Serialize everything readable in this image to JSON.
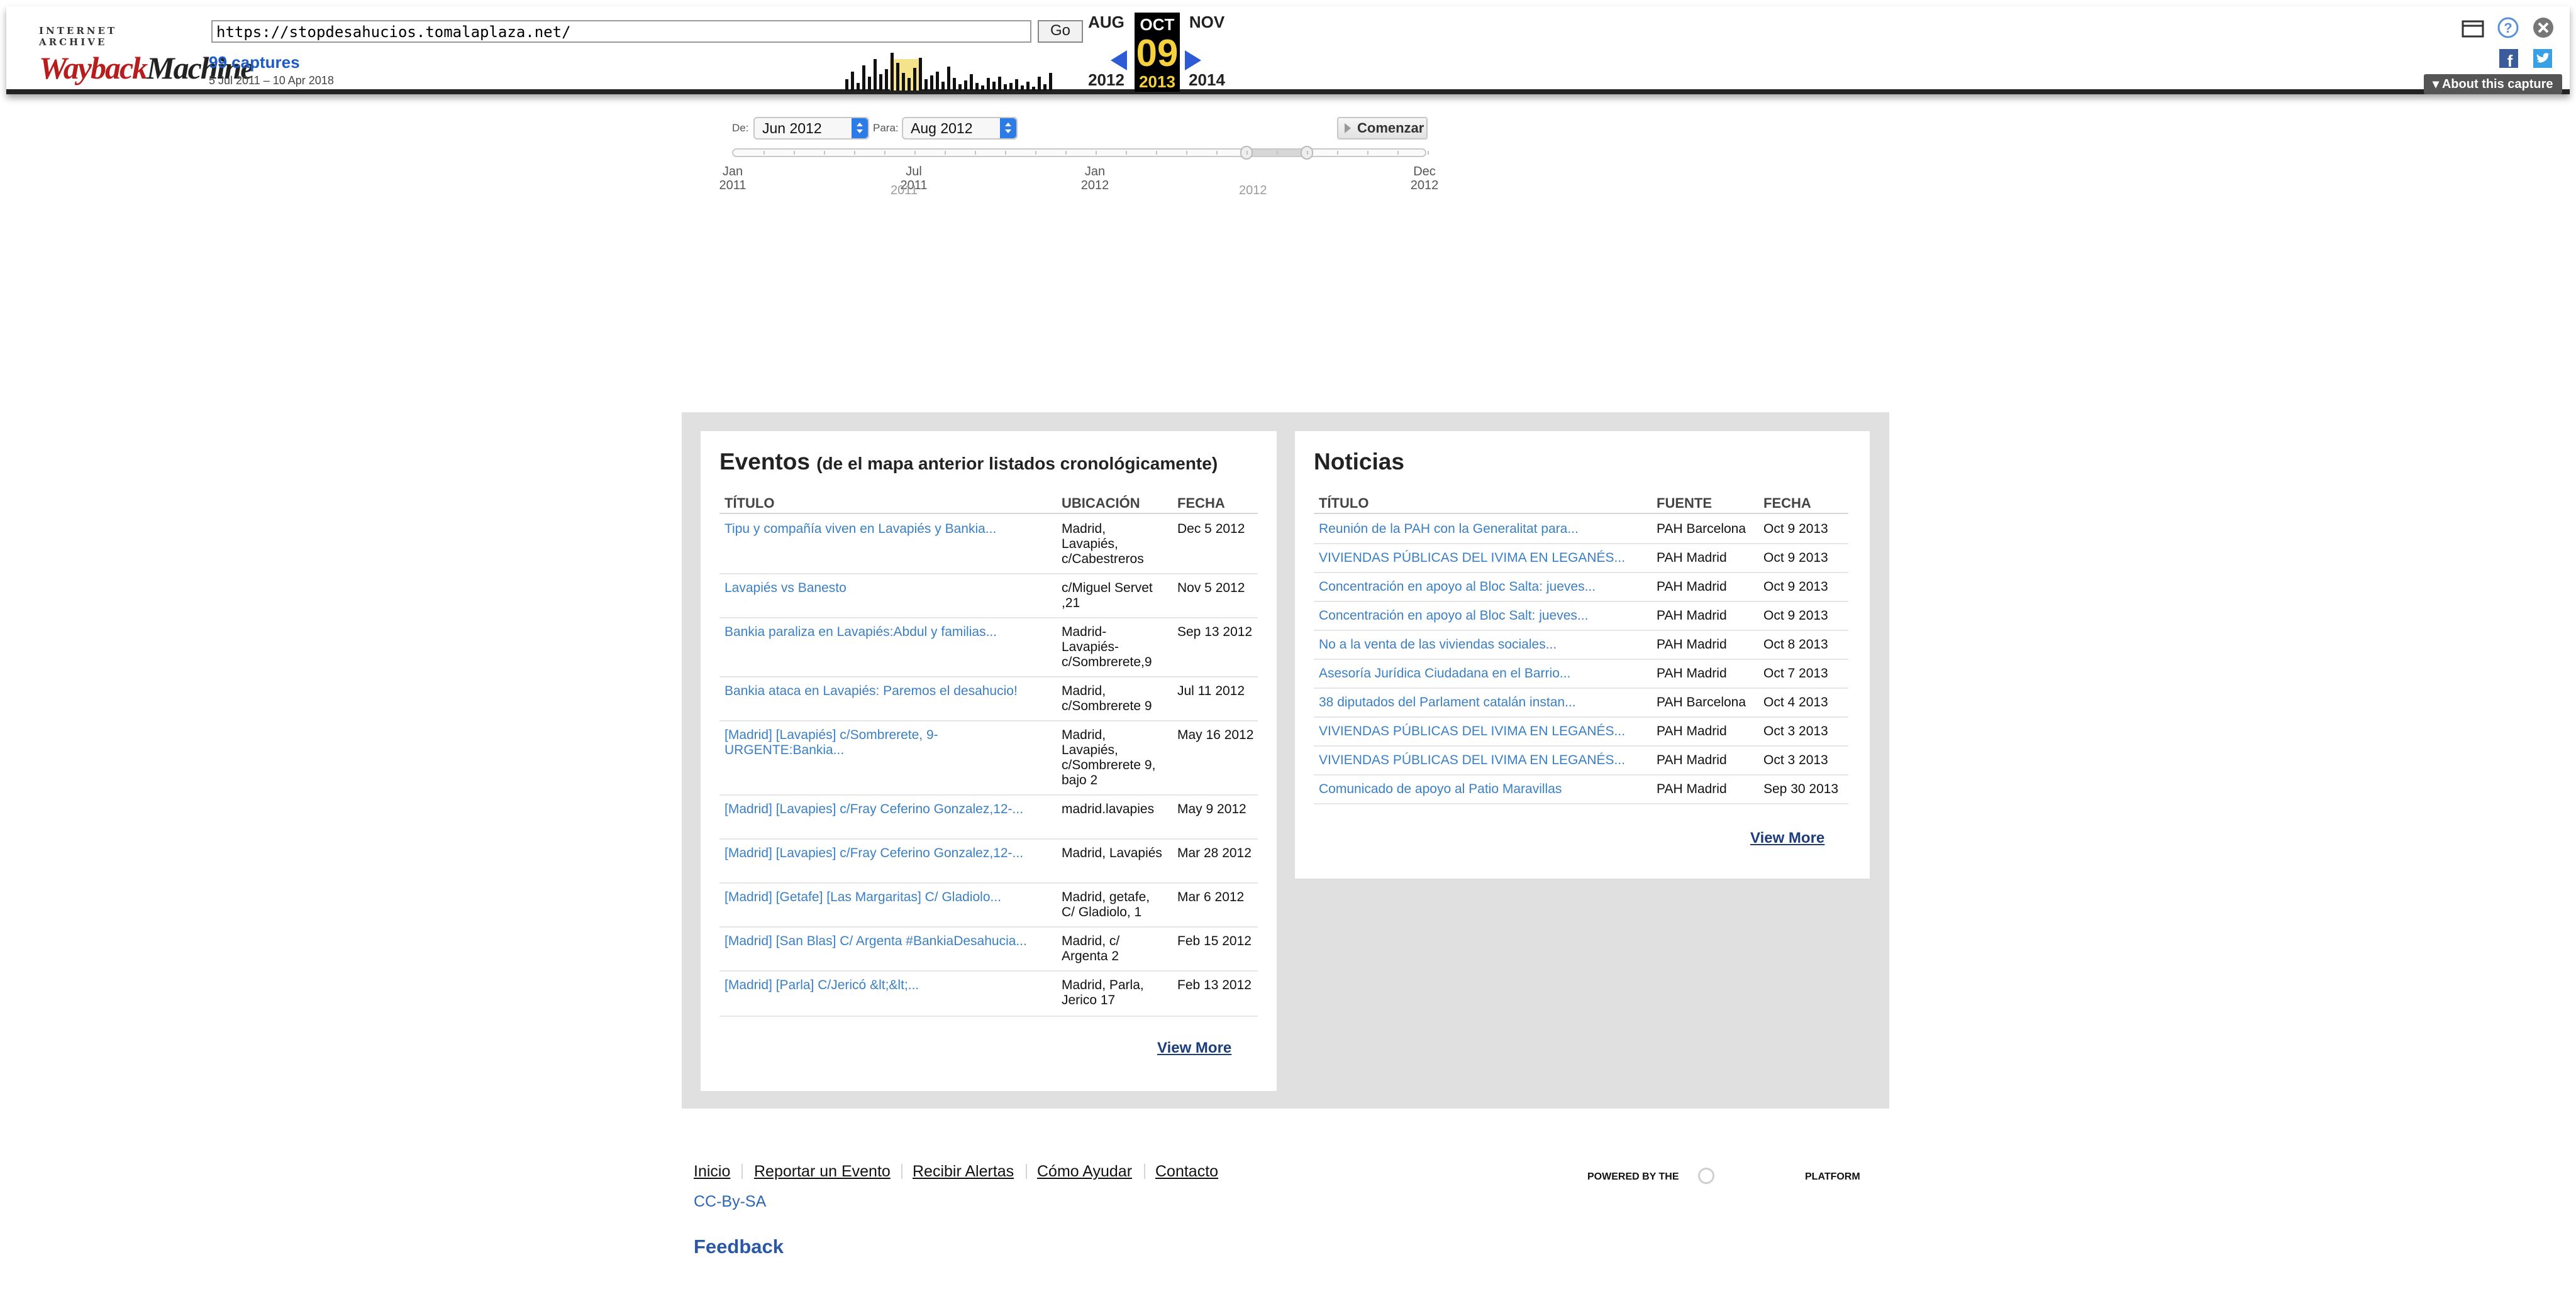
{
  "wayback": {
    "logo_top": "INTERNET ARCHIVE",
    "logo_way": "Wayback",
    "logo_machine": "Machine",
    "url": "https://stopdesahucios.tomalaplaza.net/",
    "go_label": "Go",
    "captures": "99 captures",
    "date_range": "5 Jul 2011 – 10 Apr 2018",
    "prev_month": "AUG",
    "cur_month": "OCT",
    "next_month": "NOV",
    "prev_year": "2012",
    "cur_day": "09",
    "cur_year": "2013",
    "next_year": "2014",
    "about_label": "About this capture",
    "icons": [
      "window-icon",
      "help-icon",
      "close-icon",
      "facebook-icon",
      "twitter-icon"
    ]
  },
  "timeline": {
    "from_label": "De:",
    "from_value": "Jun 2012",
    "to_label": "Para:",
    "to_value": "Aug 2012",
    "start_label": "Comenzar",
    "axis": [
      {
        "m": "Jan",
        "y": "2011"
      },
      {
        "m": "Jul",
        "y": "2011"
      },
      {
        "m": "Jan",
        "y": "2012"
      },
      {
        "m": "Dec",
        "y": "2012"
      }
    ],
    "year_labels": [
      "2011",
      "2012"
    ]
  },
  "events": {
    "title": "Eventos",
    "subtitle": "(de el mapa anterior listados cronológicamente)",
    "columns": [
      "TÍTULO",
      "UBICACIÓN",
      "FECHA"
    ],
    "rows": [
      {
        "title": "Tipu y compañía viven en Lavapiés y Bankia...",
        "loc": "Madrid, Lavapiés, c/Cabestreros",
        "date": "Dec 5 2012"
      },
      {
        "title": "Lavapiés vs Banesto",
        "loc": "c/Miguel Servet ,21",
        "date": "Nov 5 2012"
      },
      {
        "title": "Bankia paraliza en Lavapiés:Abdul y familias...",
        "loc": "Madrid-Lavapiés-c/Sombrerete,9",
        "date": "Sep 13 2012"
      },
      {
        "title": "Bankia ataca en Lavapiés: Paremos el desahucio!",
        "loc": "Madrid, c/Sombrerete 9",
        "date": "Jul 11 2012"
      },
      {
        "title": "[Madrid] [Lavapiés] c/Sombrerete, 9-URGENTE:Bankia...",
        "loc": "Madrid, Lavapiés, c/Sombrerete 9, bajo 2",
        "date": "May 16 2012"
      },
      {
        "title": "[Madrid] [Lavapies] c/Fray Ceferino Gonzalez,12-...",
        "loc": "madrid.lavapies",
        "date": "May 9 2012"
      },
      {
        "title": "[Madrid] [Lavapies] c/Fray Ceferino Gonzalez,12-...",
        "loc": "Madrid, Lavapiés",
        "date": "Mar 28 2012"
      },
      {
        "title": "[Madrid] [Getafe] [Las Margaritas] C/ Gladiolo...",
        "loc": "Madrid, getafe, C/ Gladiolo, 1",
        "date": "Mar 6 2012"
      },
      {
        "title": "[Madrid] [San Blas] C/ Argenta #BankiaDesahucia...",
        "loc": "Madrid, c/ Argenta 2",
        "date": "Feb 15 2012"
      },
      {
        "title": "[Madrid] [Parla] C/Jericó &lt;&lt;...",
        "loc": "Madrid, Parla, Jerico 17",
        "date": "Feb 13 2012"
      }
    ],
    "view_more": "View More"
  },
  "news": {
    "title": "Noticias",
    "columns": [
      "TÍTULO",
      "FUENTE",
      "FECHA"
    ],
    "rows": [
      {
        "title": "Reunión de la PAH con la Generalitat para...",
        "src": "PAH Barcelona",
        "date": "Oct 9 2013"
      },
      {
        "title": "VIVIENDAS PÚBLICAS DEL IVIMA EN LEGANÉS...",
        "src": "PAH Madrid",
        "date": "Oct 9 2013"
      },
      {
        "title": "Concentración en apoyo al Bloc Salta: jueves...",
        "src": "PAH Madrid",
        "date": "Oct 9 2013"
      },
      {
        "title": "Concentración en apoyo al Bloc Salt: jueves...",
        "src": "PAH Madrid",
        "date": "Oct 9 2013"
      },
      {
        "title": "No a la venta de las viviendas sociales...",
        "src": "PAH Madrid",
        "date": "Oct 8 2013"
      },
      {
        "title": "Asesoría Jurídica Ciudadana en el Barrio...",
        "src": "PAH Madrid",
        "date": "Oct 7 2013"
      },
      {
        "title": "38 diputados del Parlament catalán instan...",
        "src": "PAH Barcelona",
        "date": "Oct 4 2013"
      },
      {
        "title": "VIVIENDAS PÚBLICAS DEL IVIMA EN LEGANÉS...",
        "src": "PAH Madrid",
        "date": "Oct 3 2013"
      },
      {
        "title": "VIVIENDAS PÚBLICAS DEL IVIMA EN LEGANÉS...",
        "src": "PAH Madrid",
        "date": "Oct 3 2013"
      },
      {
        "title": "Comunicado de apoyo al Patio Maravillas",
        "src": "PAH Madrid",
        "date": "Sep 30 2013"
      }
    ],
    "view_more": "View More"
  },
  "footer": {
    "links": [
      "Inicio",
      "Reportar un Evento",
      "Recibir Alertas",
      "Cómo Ayudar",
      "Contacto"
    ],
    "license": "CC-By-SA",
    "feedback": "Feedback",
    "powered": "POWERED BY THE",
    "platform": "PLATFORM"
  },
  "colors": {
    "link": "#3a7fc4",
    "panel_bg": "#e0e0e0",
    "wayback_accent": "#f6d13b",
    "wayback_blue": "#2d5bd8"
  }
}
